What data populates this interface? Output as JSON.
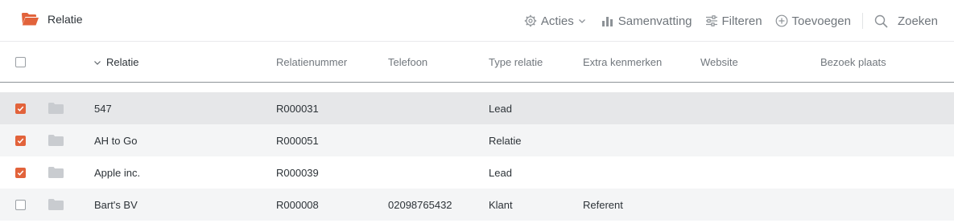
{
  "toolbar": {
    "title": "Relatie",
    "acties_label": "Acties",
    "samenvatting_label": "Samenvatting",
    "filteren_label": "Filteren",
    "toevoegen_label": "Toevoegen",
    "zoeken_label": "Zoeken"
  },
  "colors": {
    "accent": "#e2633b",
    "folder": "#c9ccd0",
    "selected_row": "#e6e7e9",
    "alt_row": "#f4f5f6"
  },
  "table": {
    "columns": [
      "Relatie",
      "Relatienummer",
      "Telefoon",
      "Type relatie",
      "Extra kenmerken",
      "Website",
      "Bezoek plaats"
    ],
    "rows": [
      {
        "checked": true,
        "relatie": "547",
        "relatienummer": "R000031",
        "telefoon": "",
        "type": "Lead",
        "extra": "",
        "website": "",
        "plaats": ""
      },
      {
        "checked": true,
        "relatie": "AH to Go",
        "relatienummer": "R000051",
        "telefoon": "",
        "type": "Relatie",
        "extra": "",
        "website": "",
        "plaats": ""
      },
      {
        "checked": true,
        "relatie": "Apple inc.",
        "relatienummer": "R000039",
        "telefoon": "",
        "type": "Lead",
        "extra": "",
        "website": "",
        "plaats": ""
      },
      {
        "checked": false,
        "relatie": "Bart's BV",
        "relatienummer": "R000008",
        "telefoon": "02098765432",
        "type": "Klant",
        "extra": "Referent",
        "website": "",
        "plaats": ""
      }
    ]
  }
}
